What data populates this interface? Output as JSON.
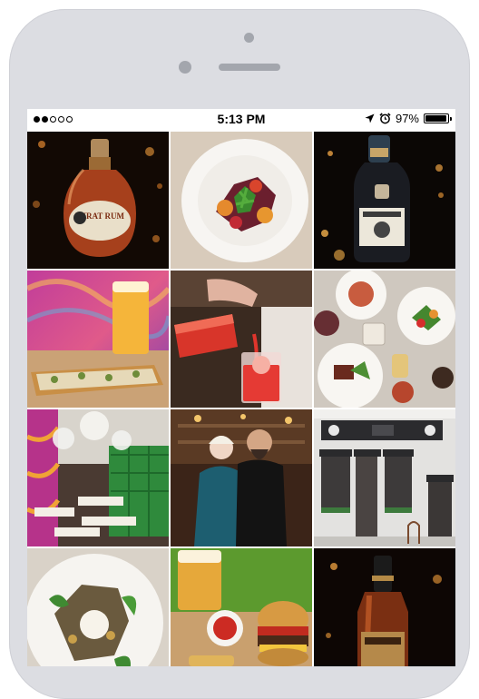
{
  "status_bar": {
    "signal_dots": [
      true,
      true,
      false,
      false,
      false
    ],
    "time": "5:13 PM",
    "battery_percent": "97%",
    "battery_level": 0.97,
    "icons": [
      "location-arrow-icon",
      "alarm-clock-icon",
      "battery-icon"
    ]
  },
  "photo_grid": {
    "photos": [
      {
        "name": "pyrat-rum-bottle",
        "subject": "Rum bottle on dark bokeh background",
        "label_text": "PYRAT RUM"
      },
      {
        "name": "beet-salad-plate",
        "subject": "Beet and carrot salad with greens on white plate"
      },
      {
        "name": "dark-rum-bottle",
        "subject": "Dark rum bottle on black background"
      },
      {
        "name": "flatbread-and-beer",
        "subject": "Flatbread pizza with a glass of beer, colorful wall"
      },
      {
        "name": "pouring-red-cocktail",
        "subject": "Bartender pouring red cocktail into glass"
      },
      {
        "name": "table-spread-overhead",
        "subject": "Overhead view of plates, wine and drinks on table"
      },
      {
        "name": "restaurant-interior",
        "subject": "Restaurant dining room with green booths and chandeliers"
      },
      {
        "name": "chef-portrait",
        "subject": "Two people posing in front of a bar"
      },
      {
        "name": "restaurant-storefront",
        "subject": "Restaurant storefront with dark awnings"
      },
      {
        "name": "burrata-salad",
        "subject": "Burrata with greens on white plate"
      },
      {
        "name": "burger-and-beer",
        "subject": "Burger with ketchup and a beer"
      },
      {
        "name": "rum-bottle-bokeh",
        "subject": "Rum bottle on dark bokeh background"
      }
    ]
  }
}
